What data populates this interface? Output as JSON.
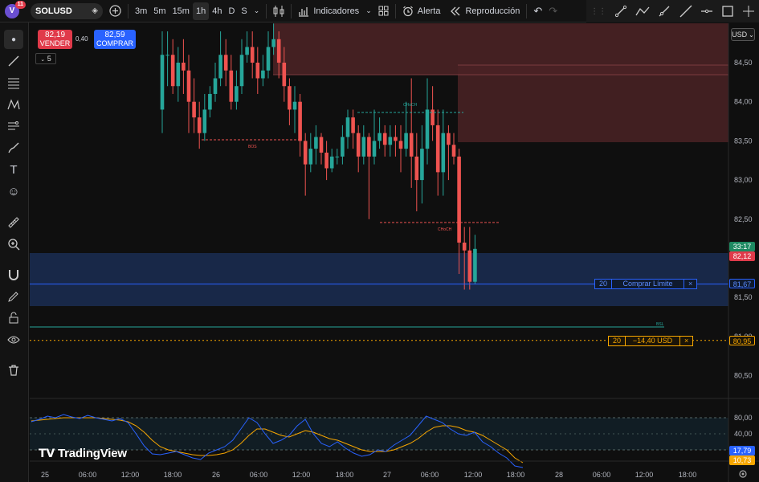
{
  "toolbar": {
    "avatar_letter": "V",
    "avatar_badge": "11",
    "symbol": "SOLUSD",
    "intervals": [
      "3m",
      "5m",
      "15m",
      "1h",
      "4h",
      "D",
      "S"
    ],
    "active_interval": "1h",
    "indicators_label": "Indicadores",
    "alert_label": "Alerta",
    "replay_label": "Reproducción"
  },
  "trade": {
    "sell_price": "82,19",
    "sell_label": "VENDER",
    "spread": "0,40",
    "buy_price": "82,59",
    "buy_label": "COMPRAR",
    "quantity": "5"
  },
  "price_axis": {
    "currency": "USD",
    "ticks": [
      "84,50",
      "84,00",
      "83,50",
      "83,00",
      "82,50",
      "81,50",
      "81,00",
      "80,50"
    ],
    "countdown": "33:17",
    "last_price": "82,12",
    "limit_price": "81,67",
    "position_price": "80,95"
  },
  "rsi_axis": {
    "ticks": [
      "80,00",
      "40,00"
    ],
    "value_rsi": "17,79",
    "value_ma": "10,73"
  },
  "orders": {
    "limit_qty": "20",
    "limit_label": "Comprar Límite",
    "pos_qty": "20",
    "pos_pnl": "−14,40 USD",
    "close_symbol": "×"
  },
  "annotations": {
    "choch_1": "CHoCH",
    "bos": "BOS",
    "choch_2": "CHoCH",
    "liquidity": "BSL"
  },
  "time_axis": {
    "labels": [
      "25",
      "06:00",
      "12:00",
      "18:00",
      "26",
      "06:00",
      "12:00",
      "18:00",
      "27",
      "06:00",
      "12:00",
      "18:00",
      "28",
      "06:00",
      "12:00",
      "18:00"
    ]
  },
  "logo": "TradingView",
  "colors": {
    "up": "#26a69a",
    "down": "#ef5350",
    "supply_zone": "#5c2a2e",
    "demand_zone": "#1a2b4a",
    "limit_line": "#2962ff",
    "position_line": "#f7a600",
    "rsi_line": "#2962ff",
    "rsi_ma": "#f7a600"
  }
}
